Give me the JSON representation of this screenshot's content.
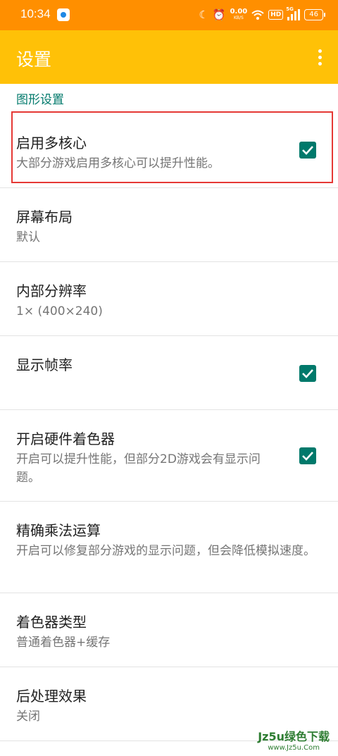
{
  "status_bar": {
    "time": "10:34",
    "net_speed_value": "0.00",
    "net_speed_unit": "KB/S",
    "hd": "HD",
    "network": "5G",
    "battery": "46"
  },
  "app_bar": {
    "title": "设置"
  },
  "section": {
    "title": "图形设置"
  },
  "settings": [
    {
      "title": "启用多核心",
      "summary": "大部分游戏启用多核心可以提升性能。",
      "checked": true
    },
    {
      "title": "屏幕布局",
      "summary": "默认"
    },
    {
      "title": "内部分辨率",
      "summary": "1× (400×240)"
    },
    {
      "title": "显示帧率",
      "summary": "",
      "checked": true
    },
    {
      "title": "开启硬件着色器",
      "summary": "开启可以提升性能，但部分2D游戏会有显示问题。",
      "checked": true
    },
    {
      "title": "精确乘法运算",
      "summary": "开启可以修复部分游戏的显示问题，但会降低模拟速度。"
    },
    {
      "title": "着色器类型",
      "summary": "普通着色器+缓存"
    },
    {
      "title": "后处理效果",
      "summary": "关闭"
    }
  ],
  "watermark": {
    "line1": "Jz5u绿色下载",
    "line2": "www.Jz5u.Com"
  },
  "colors": {
    "status_bar": "#ff8f00",
    "app_bar": "#ffc107",
    "accent": "#00796b",
    "highlight": "#e53935"
  }
}
